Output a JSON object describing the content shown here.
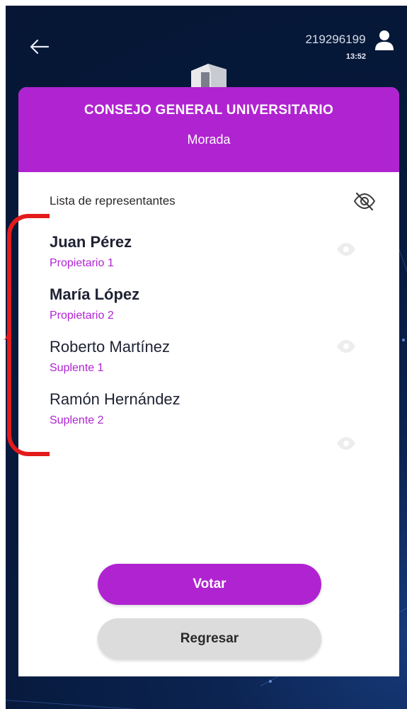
{
  "header": {
    "user_id": "219296199",
    "time": "13:52"
  },
  "card": {
    "title": "CONSEJO GENERAL UNIVERSITARIO",
    "subtitle": "Morada",
    "list_label": "Lista de representantes"
  },
  "representatives": [
    {
      "name": "Juan Pérez",
      "role": "Propietario 1",
      "bold": true
    },
    {
      "name": "María López",
      "role": "Propietario 2",
      "bold": true
    },
    {
      "name": "Roberto Martínez",
      "role": "Suplente 1",
      "bold": false
    },
    {
      "name": "Ramón Hernández",
      "role": "Suplente 2",
      "bold": false
    }
  ],
  "buttons": {
    "vote": "Votar",
    "back": "Regresar"
  },
  "icons": {
    "back": "arrow-left-icon",
    "user": "user-icon",
    "visibility": "eye-slash-icon",
    "row_visibility": "eye-icon",
    "logo": "logo-icon"
  },
  "colors": {
    "accent": "#b023d1",
    "background": "#071a3d",
    "secondary_button": "#dcdcdc",
    "annotation": "#e41b1b"
  }
}
